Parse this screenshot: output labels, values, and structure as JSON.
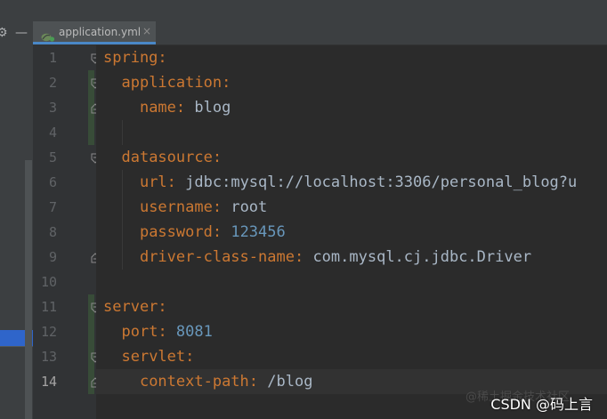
{
  "tab": {
    "filename": "application.yml",
    "close_glyph": "×",
    "icon": "spring-leaf-icon"
  },
  "panel": {
    "settings_glyph": "⚙",
    "minimize_glyph": "—"
  },
  "gutter": {
    "current_line": 14,
    "line_numbers": [
      "1",
      "2",
      "3",
      "4",
      "5",
      "6",
      "7",
      "8",
      "9",
      "10",
      "11",
      "12",
      "13",
      "14"
    ]
  },
  "code": {
    "l1_key": "spring",
    "l2_key": "application",
    "l3_key": "name",
    "l3_val": "blog",
    "l5_key": "datasource",
    "l6_key": "url",
    "l6_val": "jdbc:mysql://localhost:3306/personal_blog?u",
    "l7_key": "username",
    "l7_val": "root",
    "l8_key": "password",
    "l8_val": "123456",
    "l9_key": "driver-class-name",
    "l9_val": "com.mysql.cj.jdbc.Driver",
    "l11_key": "server",
    "l12_key": "port",
    "l12_val": "8081",
    "l13_key": "servlet",
    "l14_key": "context-path",
    "l14_val": "/blog"
  },
  "watermark": {
    "text": "CSDN @码上言",
    "ghost": "@稀土掘金技术社区"
  },
  "colors": {
    "keyword": "#cc7832",
    "string": "#a9b7c6",
    "number": "#6897bb",
    "background": "#2b2b2b",
    "gutter": "#313335",
    "tab_active_underline": "#4a88c7"
  }
}
